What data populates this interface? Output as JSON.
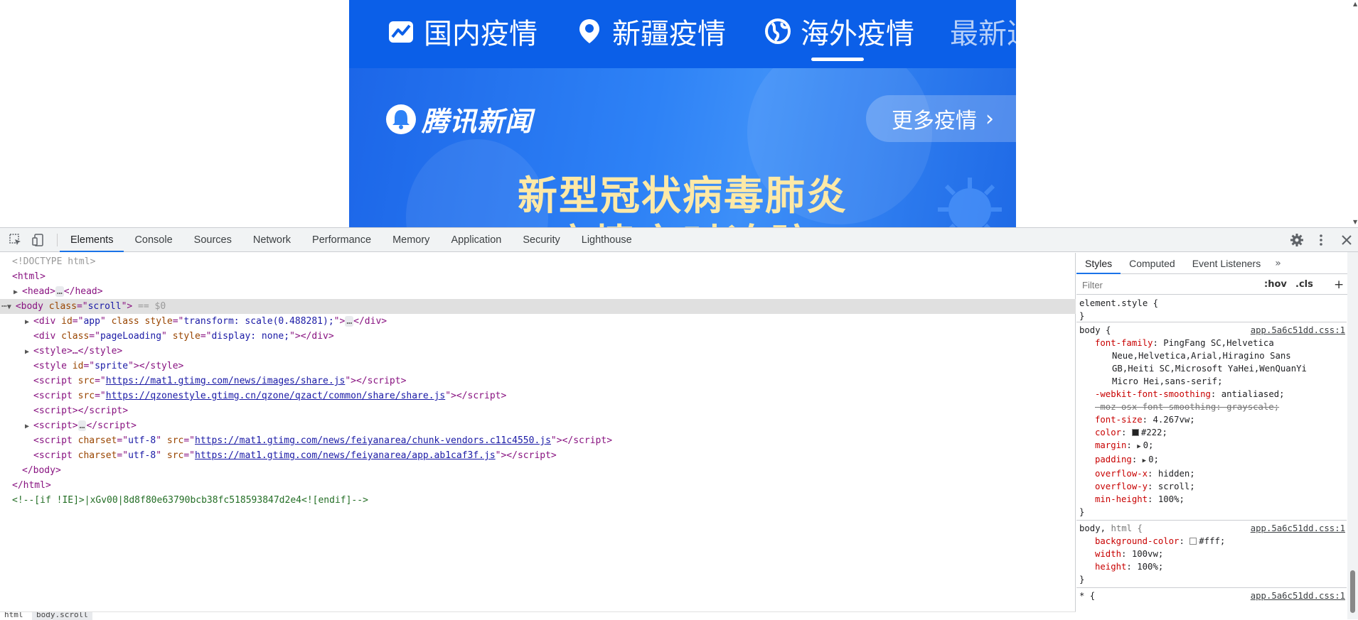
{
  "viewport": {
    "nav_tabs": [
      {
        "label": "国内疫情",
        "icon": "trend-chart-icon"
      },
      {
        "label": "新疆疫情",
        "icon": "location-pin-icon"
      },
      {
        "label": "海外疫情",
        "icon": "globe-icon"
      },
      {
        "label": "最新进",
        "icon": ""
      }
    ],
    "active_tab": "海外疫情",
    "banner": {
      "logo_text": "腾讯新闻",
      "more_button": "更多疫情",
      "headline": "新型冠状病毒肺炎",
      "headline2": "疫情实时追踪"
    },
    "colors": {
      "nav_bg": "#0b5fe8",
      "headline": "#fde9a6"
    }
  },
  "devtools": {
    "tabs": [
      "Elements",
      "Console",
      "Sources",
      "Network",
      "Performance",
      "Memory",
      "Application",
      "Security",
      "Lighthouse"
    ],
    "active_tab": "Elements",
    "toolbar_icons": [
      "inspect-element-icon",
      "device-toolbar-icon",
      "settings-gear-icon",
      "more-options-icon",
      "close-icon"
    ],
    "dom": {
      "doctype": "<!DOCTYPE html>",
      "html_open": "<html>",
      "head": {
        "open": "<head>",
        "ellipsis": "…",
        "close": "</head>"
      },
      "body": {
        "tag": "body",
        "attr": "class",
        "value": "scroll",
        "marker": "== $0"
      },
      "app_div": {
        "id": "app",
        "style": "transform: scale(0.488281);"
      },
      "loading_div": {
        "class": "pageLoading",
        "style": "display: none;"
      },
      "style_collapsed": "<style>…</style>",
      "style_sprite": {
        "id": "sprite"
      },
      "script_share": "https://mat1.gtimg.com/news/images/share.js",
      "script_qzone": "https://qzonestyle.gtimg.cn/qzone/qzact/common/share/share.js",
      "script_vendors": "https://mat1.gtimg.com/news/feiyanarea/chunk-vendors.c11c4550.js",
      "script_app": "https://mat1.gtimg.com/news/feiyanarea/app.ab1caf3f.js",
      "charset": "utf-8",
      "comment": "<!--[if !IE]>|xGv00|8d8f80e63790bcb38fc518593847d2e4<![endif]-->",
      "body_close": "</body>",
      "html_close": "</html>"
    },
    "breadcrumbs": [
      "html",
      "body.scroll"
    ],
    "styles_pane": {
      "tabs": [
        "Styles",
        "Computed",
        "Event Listeners"
      ],
      "active_tab": "Styles",
      "more_tabs": "»",
      "filter_placeholder": "Filter",
      "hov": ":hov",
      "cls": ".cls",
      "add": "+",
      "element_style": "element.style {",
      "close_brace": "}",
      "body_rule": {
        "selector": "body {",
        "source": "app.5a6c51dd.css:1",
        "font_family_name": "font-family",
        "font_family_l1": "PingFang SC,Helvetica",
        "font_family_l2": "Neue,Helvetica,Arial,Hiragino Sans",
        "font_family_l3": "GB,Heiti SC,Microsoft YaHei,WenQuanYi",
        "font_family_l4": "Micro Hei,sans-serif;",
        "smoothing_name": "-webkit-font-smoothing",
        "smoothing_value": "antialiased;",
        "moz_smoothing": "-moz-osx-font-smoothing: grayscale;",
        "font_size_name": "font-size",
        "font_size_value": "4.267vw;",
        "color_name": "color",
        "color_value": "#222;",
        "margin_name": "margin",
        "margin_value": "0;",
        "padding_name": "padding",
        "padding_value": "0;",
        "overflow_x_name": "overflow-x",
        "overflow_x_value": "hidden;",
        "overflow_y_name": "overflow-y",
        "overflow_y_value": "scroll;",
        "min_height_name": "min-height",
        "min_height_value": "100%;"
      },
      "body_html_rule": {
        "selector": "body,",
        "selector2": "html {",
        "source": "app.5a6c51dd.css:1",
        "bg_name": "background-color",
        "bg_value": "#fff;",
        "width_name": "width",
        "width_value": "100vw;",
        "height_name": "height",
        "height_value": "100%;"
      },
      "star_rule": {
        "selector": "* {",
        "source": "app.5a6c51dd.css:1"
      }
    }
  }
}
